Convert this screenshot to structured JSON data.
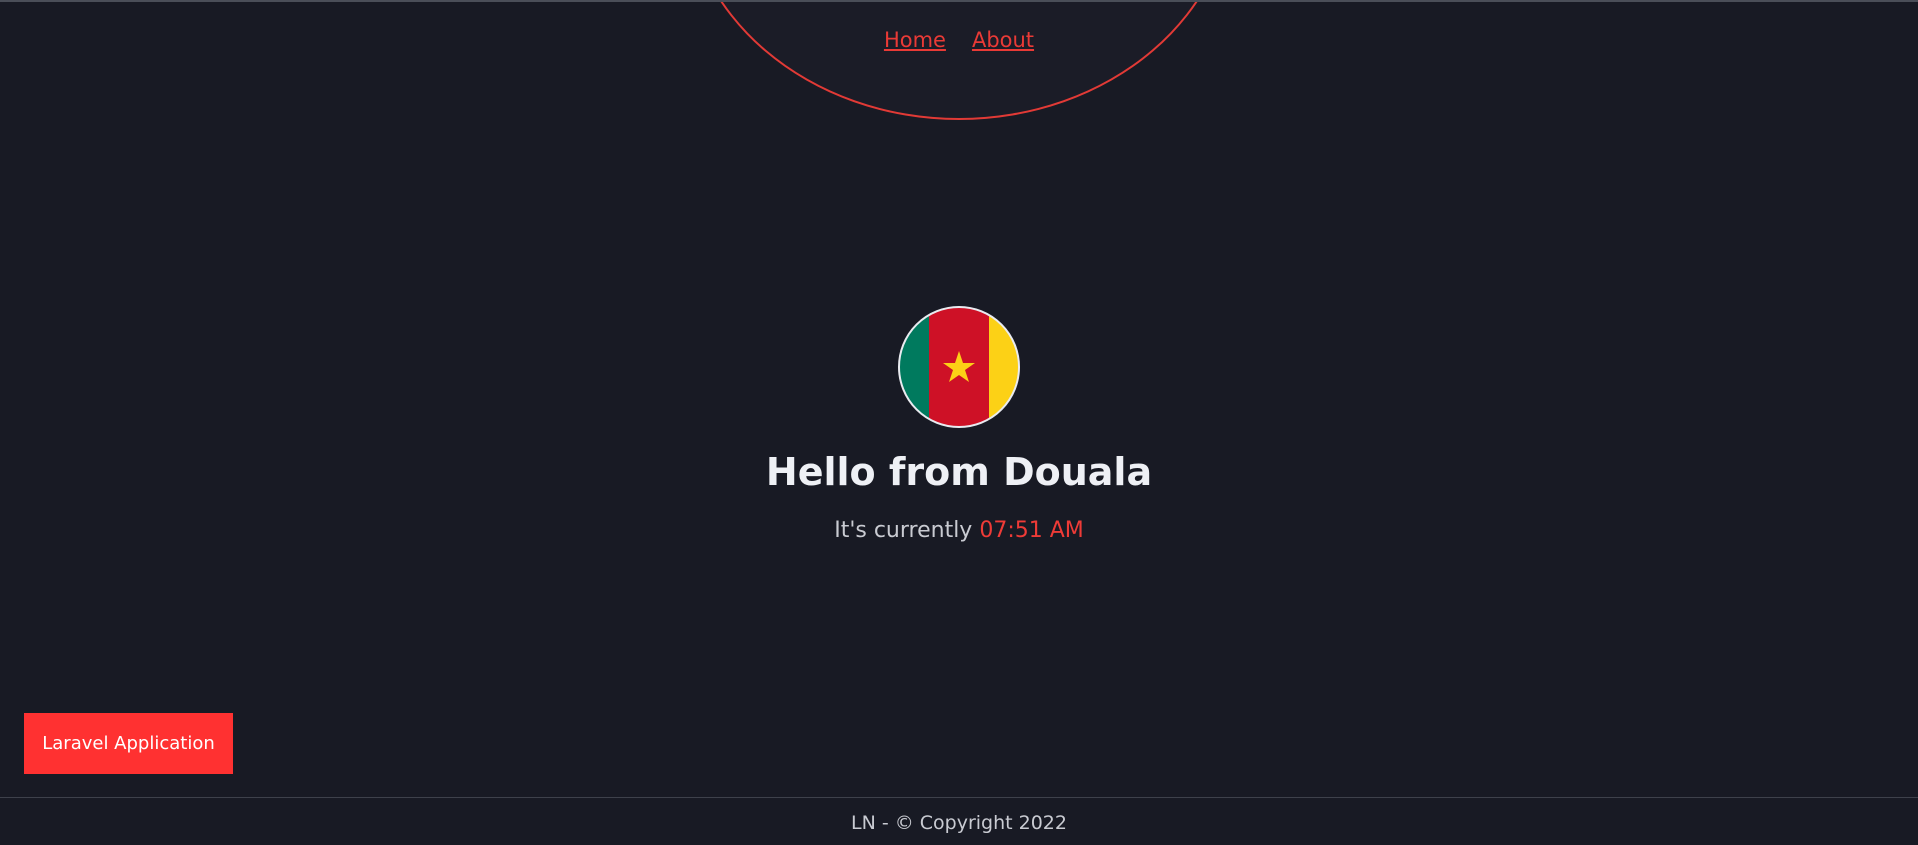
{
  "nav": {
    "items": [
      {
        "label": "Home"
      },
      {
        "label": "About"
      }
    ]
  },
  "hero": {
    "flag_icon": "cameroon-flag-icon",
    "flag_colors": {
      "green": "#007a5e",
      "red": "#ce1126",
      "yellow": "#fcd116"
    },
    "title": "Hello from Douala",
    "subtitle_prefix": "It's currently",
    "time": "07:51 AM"
  },
  "badge": {
    "label": "Laravel Application"
  },
  "footer": {
    "text": "LN - © Copyright 2022"
  },
  "colors": {
    "accent": "#ff3131",
    "background": "#181a24"
  }
}
